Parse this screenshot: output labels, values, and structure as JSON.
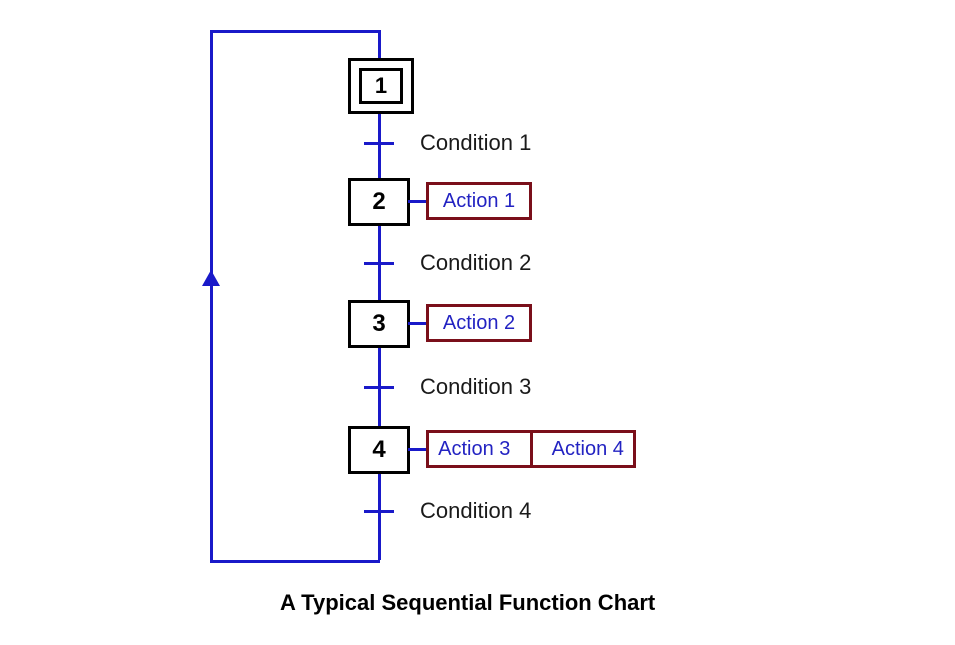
{
  "diagram": {
    "steps": {
      "s1": "1",
      "s2": "2",
      "s3": "3",
      "s4": "4"
    },
    "conditions": {
      "c1": "Condition 1",
      "c2": "Condition 2",
      "c3": "Condition 3",
      "c4": "Condition 4"
    },
    "actions": {
      "a1": "Action 1",
      "a2": "Action 2",
      "a3": "Action 3",
      "a4": "Action 4"
    },
    "caption": "A Typical Sequential Function Chart"
  },
  "colors": {
    "line": "#1919c9",
    "action_border": "#7a0f1a",
    "action_text": "#2323c2",
    "step_border": "#000000"
  }
}
